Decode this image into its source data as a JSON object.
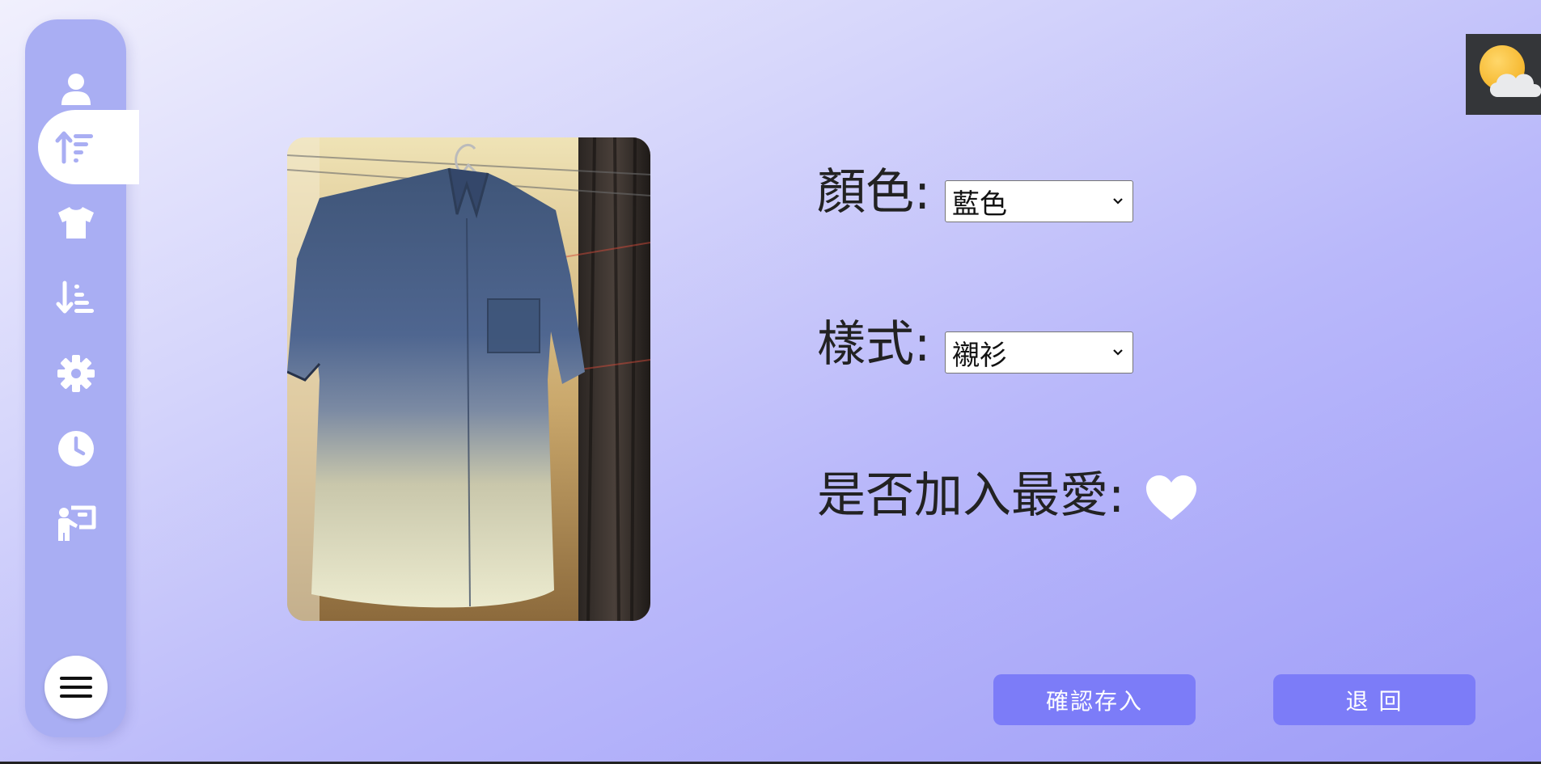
{
  "sidebar": {
    "items": [
      {
        "icon": "user-icon",
        "active": false
      },
      {
        "icon": "sort-ascending-icon",
        "active": true
      },
      {
        "icon": "shirt-icon",
        "active": false
      },
      {
        "icon": "sort-descending-icon",
        "active": false
      },
      {
        "icon": "gear-icon",
        "active": false
      },
      {
        "icon": "clock-icon",
        "active": false
      },
      {
        "icon": "presenter-icon",
        "active": false
      }
    ],
    "menu_icon": "hamburger-menu-icon",
    "color": "#a9aef3"
  },
  "weather": {
    "icon": "partly-cloudy-icon"
  },
  "form": {
    "color_label": "顏色:",
    "color_value": "藍色",
    "style_label": "樣式:",
    "style_value": "襯衫",
    "favorite_label": "是否加入最愛:",
    "favorite_icon": "heart-icon"
  },
  "buttons": {
    "confirm_label": "確認存入",
    "back_label": "退 回"
  },
  "colors": {
    "button": "#7c7cf8",
    "sidebar": "#a9aef3"
  }
}
